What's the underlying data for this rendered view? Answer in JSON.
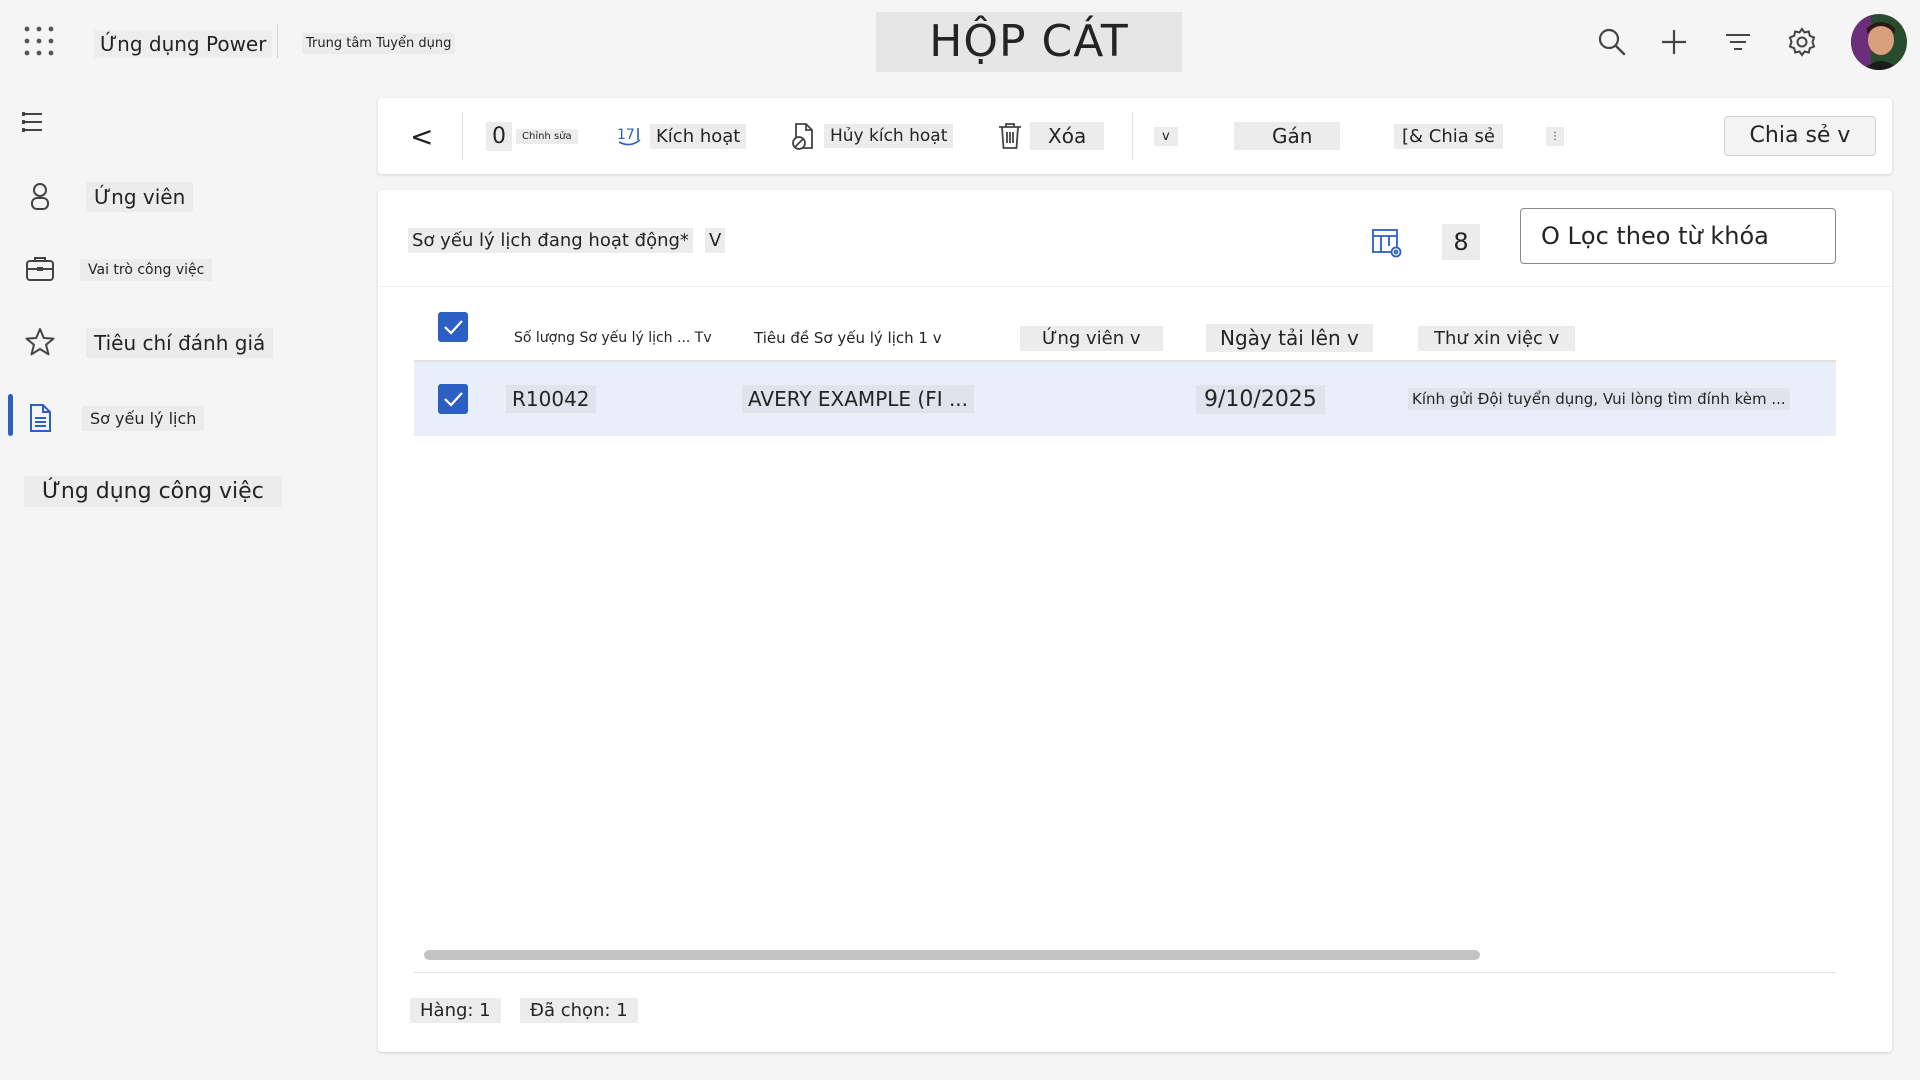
{
  "topbar": {
    "app_name": "Ứng dụng Power",
    "sub_app": "Trung tâm Tuyển dụng",
    "environment": "HỘP CÁT",
    "icons": [
      "waffle-icon",
      "search-icon",
      "add-icon",
      "filter-icon",
      "settings-icon",
      "avatar"
    ]
  },
  "sidebar": {
    "items": [
      {
        "label": "Ứng viên",
        "icon": "person-icon"
      },
      {
        "label": "Vai trò công việc",
        "icon": "briefcase-icon"
      },
      {
        "label": "Tiêu chí đánh giá",
        "icon": "star-icon"
      },
      {
        "label": "Sơ yếu lý lịch",
        "icon": "document-icon",
        "active": true
      }
    ],
    "footer_label": "Ứng dụng công việc"
  },
  "commandbar": {
    "back": "<",
    "edit_glyph": "0",
    "edit_label": "Chỉnh sửa",
    "activate_label": "Kích hoạt",
    "deactivate_label": "Hủy kích hoạt",
    "delete_label": "Xóa",
    "dropdown_label": "v",
    "assign_label": "Gán",
    "share_label": "[& Chia sẻ",
    "more_label": "⋮",
    "share_button": "Chia sẻ v"
  },
  "view": {
    "name": "Sơ yếu lý lịch đang hoạt động*",
    "chevron": "V",
    "count_badge": "8",
    "search_value": "O Lọc theo từ khóa"
  },
  "table": {
    "columns": [
      "Số lượng Sơ yếu lý lịch ... Tv",
      "Tiêu đề Sơ yếu lý lịch 1 v",
      "Ứng viên v",
      "Ngày tải lên v",
      "Thư xin việc v"
    ],
    "rows": [
      {
        "resume_number": "R10042",
        "title": "AVERY EXAMPLE (FI ...",
        "candidate": "",
        "upload_date": "9/10/2025",
        "cover_letter": "Kính gửi Đội tuyển dụng, Vui lòng tìm đính kèm ..."
      }
    ]
  },
  "status": {
    "rows": "Hàng: 1",
    "selected": "Đã chọn: 1"
  },
  "colors": {
    "accent": "#2b5fc2",
    "selected_row": "#e8eff9",
    "page_bg": "#f5f5f5"
  }
}
